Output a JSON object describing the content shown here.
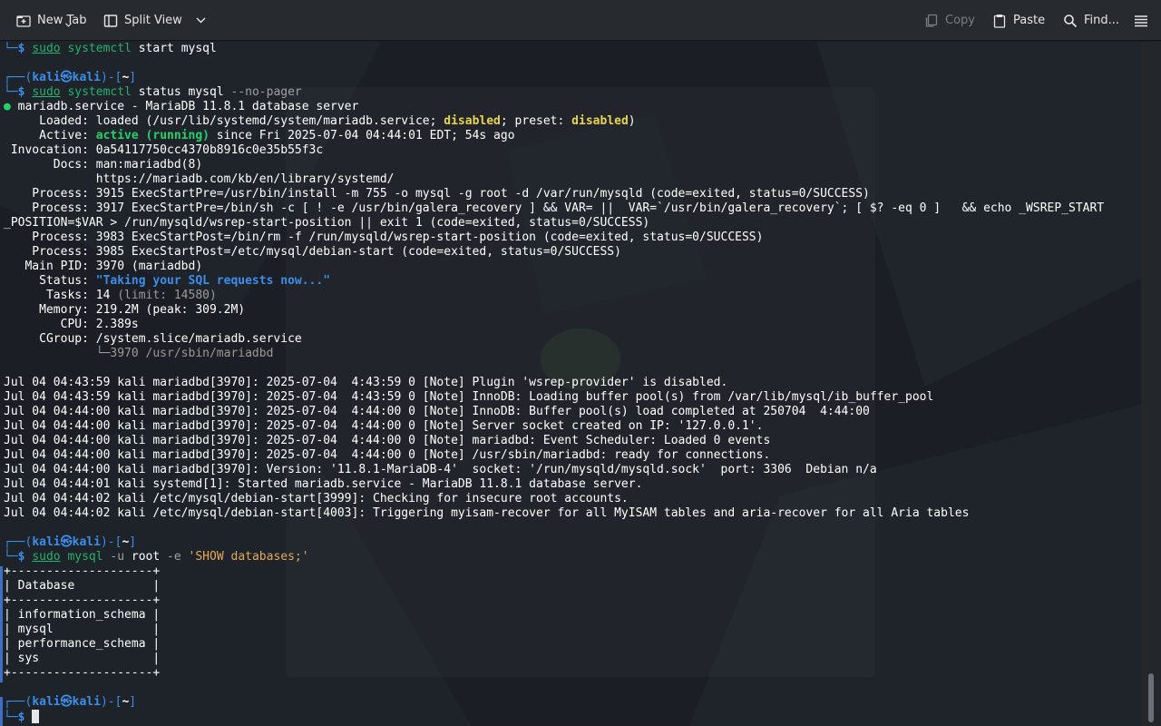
{
  "toolbar": {
    "new_tab": "New Tab",
    "split_view": "Split View",
    "copy": "Copy",
    "paste": "Paste",
    "find": "Find..."
  },
  "prompt": {
    "user": "kali",
    "at": "㉿",
    "host": "kali",
    "path": "~"
  },
  "cmd_start": {
    "sudo": "sudo",
    "cmd": "systemctl",
    "args": " start mysql"
  },
  "cmd_status": {
    "sudo": "sudo",
    "cmd": "systemctl",
    "args": " status mysql ",
    "flag": "--no-pager"
  },
  "status": {
    "dot": "●",
    "title": " mariadb.service - MariaDB 11.8.1 database server",
    "loaded_a": "     Loaded: loaded (/usr/lib/systemd/system/mariadb.service; ",
    "disabled1": "disabled",
    "loaded_b": "; preset: ",
    "disabled2": "disabled",
    "loaded_c": ")",
    "active_a": "     Active: ",
    "active_state": "active (running)",
    "active_b": " since Fri 2025-07-04 04:44:01 EDT; 54s ago",
    "invocation": " Invocation: 0a54117750cc4370b8916c0e35b55f3c",
    "docs1": "       Docs: man:mariadbd(8)",
    "docs2": "             https://mariadb.com/kb/en/library/systemd/",
    "process1": "    Process: 3915 ExecStartPre=/usr/bin/install -m 755 -o mysql -g root -d /var/run/mysqld (code=exited, status=0/SUCCESS)",
    "process2a": "    Process: 3917 ExecStartPre=/bin/sh -c [ ! -e /usr/bin/galera_recovery ] && VAR= ||  VAR=`/usr/bin/galera_recovery`; [ $? -eq 0 ]   && echo _WSREP_START",
    "process2b": "_POSITION=$VAR > /run/mysqld/wsrep-start-position || exit 1 (code=exited, status=0/SUCCESS)",
    "process3": "    Process: 3983 ExecStartPost=/bin/rm -f /run/mysqld/wsrep-start-position (code=exited, status=0/SUCCESS)",
    "process4": "    Process: 3985 ExecStartPost=/etc/mysql/debian-start (code=exited, status=0/SUCCESS)",
    "mainpid": "   Main PID: 3970 (mariadbd)",
    "status_a": "     Status: ",
    "status_msg": "\"Taking your SQL requests now...\"",
    "tasks_a": "      Tasks: 14 ",
    "tasks_limit": "(limit: 14580)",
    "memory": "     Memory: 219.2M (peak: 309.2M)",
    "cpu": "        CPU: 2.389s",
    "cgroup": "     CGroup: /system.slice/mariadb.service",
    "cgroup_child": "             └─3970 /usr/sbin/mariadbd"
  },
  "journal": [
    "Jul 04 04:43:59 kali mariadbd[3970]: 2025-07-04  4:43:59 0 [Note] Plugin 'wsrep-provider' is disabled.",
    "Jul 04 04:43:59 kali mariadbd[3970]: 2025-07-04  4:43:59 0 [Note] InnoDB: Loading buffer pool(s) from /var/lib/mysql/ib_buffer_pool",
    "Jul 04 04:44:00 kali mariadbd[3970]: 2025-07-04  4:44:00 0 [Note] InnoDB: Buffer pool(s) load completed at 250704  4:44:00",
    "Jul 04 04:44:00 kali mariadbd[3970]: 2025-07-04  4:44:00 0 [Note] Server socket created on IP: '127.0.0.1'.",
    "Jul 04 04:44:00 kali mariadbd[3970]: 2025-07-04  4:44:00 0 [Note] mariadbd: Event Scheduler: Loaded 0 events",
    "Jul 04 04:44:00 kali mariadbd[3970]: 2025-07-04  4:44:00 0 [Note] /usr/sbin/mariadbd: ready for connections.",
    "Jul 04 04:44:00 kali mariadbd[3970]: Version: '11.8.1-MariaDB-4'  socket: '/run/mysqld/mysqld.sock'  port: 3306  Debian n/a",
    "Jul 04 04:44:01 kali systemd[1]: Started mariadb.service - MariaDB 11.8.1 database server.",
    "Jul 04 04:44:02 kali /etc/mysql/debian-start[3999]: Checking for insecure root accounts.",
    "Jul 04 04:44:02 kali /etc/mysql/debian-start[4003]: Triggering myisam-recover for all MyISAM tables and aria-recover for all Aria tables"
  ],
  "cmd_mysql": {
    "sudo": "sudo",
    "cmd": "mysql",
    "flag1": " -u",
    "mid": " root",
    "flag2": " -e",
    "str": " 'SHOW databases;'"
  },
  "db_table": {
    "border": "+--------------------+",
    "header": "| Database           |",
    "rows": [
      "| information_schema |",
      "| mysql              |",
      "| performance_schema |",
      "| sys                |"
    ]
  },
  "colors": {
    "prompt_blue": "#3b8eea",
    "command_green": "#24b36a",
    "active_green": "#24d26b",
    "disabled_yellow": "#e8d44d",
    "string_orange": "#e6a95a"
  },
  "icons": [
    "new-tab-icon",
    "split-view-icon",
    "chevron-down-icon",
    "copy-icon",
    "paste-icon",
    "search-icon",
    "hamburger-menu-icon"
  ]
}
